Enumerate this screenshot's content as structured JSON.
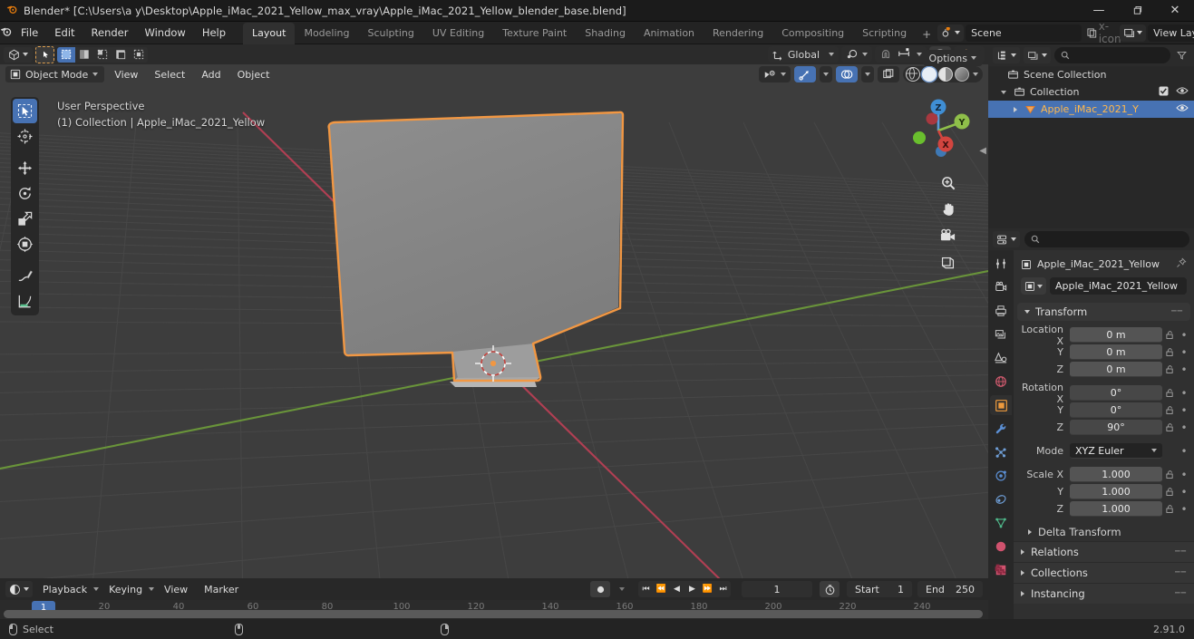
{
  "window": {
    "title": "Blender* [C:\\Users\\a y\\Desktop\\Apple_iMac_2021_Yellow_max_vray\\Apple_iMac_2021_Yellow_blender_base.blend]",
    "logo_icon": "blender-logo-icon",
    "minimize_icon": "minimize-icon",
    "maximize_icon": "maximize-icon",
    "close_icon": "close-icon"
  },
  "topbar": {
    "menus": [
      "File",
      "Edit",
      "Render",
      "Window",
      "Help"
    ],
    "workspaces": [
      {
        "label": "Layout",
        "active": true
      },
      {
        "label": "Modeling",
        "active": false
      },
      {
        "label": "Sculpting",
        "active": false
      },
      {
        "label": "UV Editing",
        "active": false
      },
      {
        "label": "Texture Paint",
        "active": false
      },
      {
        "label": "Shading",
        "active": false
      },
      {
        "label": "Animation",
        "active": false
      },
      {
        "label": "Rendering",
        "active": false
      },
      {
        "label": "Compositing",
        "active": false
      },
      {
        "label": "Scripting",
        "active": false
      }
    ],
    "add_workspace": "+",
    "scene_name": "Scene",
    "view_layer_name": "View Layer",
    "new_scene_icon": "duplicate-icon",
    "remove_scene_icon": "x-icon"
  },
  "viewport": {
    "editor_type_icon": "editor-type-icon",
    "mode": "Object Mode",
    "menus": [
      "View",
      "Select",
      "Add",
      "Object"
    ],
    "transform_orientation": "Global",
    "orientation_icon": "orientation-icon",
    "pivot_icon": "pivot-point-icon",
    "snap_icon": "magnet-icon",
    "snap_to_icon": "snap-increment-icon",
    "proportional_icon": "proportional-edit-icon",
    "falloff_icon": "falloff-curve-icon",
    "options_label": "Options",
    "select_mode_icons": [
      "select-box-icon",
      "select-extend-icon",
      "select-subtract-icon",
      "select-invert-icon",
      "select-intersect-icon"
    ],
    "cursor_icon": "cursor-icon",
    "visibility_icon": "show-hide-icon",
    "gizmo_icon": "gizmo-icon",
    "overlays_icon": "overlays-icon",
    "xray_icon": "toggle-xray-icon",
    "shading_modes": [
      "wireframe-shading-icon",
      "solid-shading-icon",
      "material-preview-icon",
      "rendered-shading-icon"
    ],
    "overlay_line1": "User Perspective",
    "overlay_line2": "(1) Collection | Apple_iMac_2021_Yellow",
    "tools": [
      {
        "name": "tweak-tool",
        "active": true
      },
      {
        "name": "cursor-tool",
        "active": false
      },
      {
        "name": "move-tool",
        "active": false
      },
      {
        "name": "rotate-tool",
        "active": false
      },
      {
        "name": "scale-tool",
        "active": false
      },
      {
        "name": "transform-tool",
        "active": false
      },
      {
        "name": "annotate-tool",
        "active": false
      },
      {
        "name": "measure-tool",
        "active": false
      }
    ],
    "gizmo_axes": [
      "Z",
      "Y",
      "X"
    ],
    "nav_buttons": [
      "zoom-icon",
      "pan-hand-icon",
      "camera-view-icon",
      "ortho-persp-icon"
    ],
    "colors": {
      "background": "#3d3d3d",
      "object_outline": "#f19743",
      "x_axis": "#c7415a",
      "y_axis": "#7bab3b",
      "accent": "#4772b3"
    }
  },
  "timeline": {
    "editor_icon": "timeline-editor-icon",
    "menus": [
      "Playback",
      "Keying",
      "View",
      "Marker"
    ],
    "record_icon": "auto-keying-icon",
    "transport_icons": [
      "jump-start-icon",
      "prev-keyframe-icon",
      "play-reverse-icon",
      "play-icon",
      "next-keyframe-icon",
      "jump-end-icon"
    ],
    "current_frame": "1",
    "clock_icon": "use-preview-range-icon",
    "start_label": "Start",
    "start_value": "1",
    "end_label": "End",
    "end_value": "250",
    "ruler_ticks": [
      "20",
      "40",
      "60",
      "80",
      "100",
      "120",
      "140",
      "160",
      "180",
      "200",
      "220",
      "240"
    ],
    "playhead_frame": "1"
  },
  "outliner": {
    "display_mode_icon": "outliner-display-mode-icon",
    "filter_id_icon": "id-type-filter-icon",
    "search_placeholder": "",
    "search_icon": "search-icon",
    "filter_icon": "filter-funnel-icon",
    "rows": [
      {
        "label": "Scene Collection",
        "icon": "scene-collection-icon",
        "indent": 0,
        "disclosure": "",
        "selected": false,
        "checkbox": false,
        "eye": false
      },
      {
        "label": "Collection",
        "icon": "collection-icon",
        "indent": 1,
        "disclosure": "down",
        "selected": false,
        "checkbox": true,
        "eye": true
      },
      {
        "label": "Apple_iMac_2021_Y",
        "icon": "mesh-object-icon",
        "indent": 2,
        "disclosure": "right",
        "selected": true,
        "checkbox": false,
        "eye": true
      }
    ]
  },
  "properties": {
    "editor_icon": "properties-editor-icon",
    "search_placeholder": "",
    "search_icon": "search-icon",
    "tabs": [
      {
        "name": "tool-tab",
        "icon": "tool-icon",
        "color": "#c8c8c8",
        "active": false
      },
      {
        "name": "render-tab",
        "icon": "render-camera-icon",
        "color": "#c8c8c8",
        "active": false
      },
      {
        "name": "output-tab",
        "icon": "printer-icon",
        "color": "#c8c8c8",
        "active": false
      },
      {
        "name": "view-layer-tab",
        "icon": "images-icon",
        "color": "#c8c8c8",
        "active": false
      },
      {
        "name": "scene-tab",
        "icon": "scene-cone-icon",
        "color": "#c8c8c8",
        "active": false
      },
      {
        "name": "world-tab",
        "icon": "world-globe-icon",
        "color": "#d05a6e",
        "active": false
      },
      {
        "name": "object-tab",
        "icon": "object-square-icon",
        "color": "#ed9a3d",
        "active": true
      },
      {
        "name": "modifiers-tab",
        "icon": "wrench-icon",
        "color": "#5b8fd4",
        "active": false
      },
      {
        "name": "particles-tab",
        "icon": "particles-icon",
        "color": "#6f9fd8",
        "active": false
      },
      {
        "name": "physics-tab",
        "icon": "physics-orbit-icon",
        "color": "#5b8fd4",
        "active": false
      },
      {
        "name": "constraints-tab",
        "icon": "constraints-icon",
        "color": "#6f9fd8",
        "active": false
      },
      {
        "name": "object-data-tab",
        "icon": "mesh-data-triangle-icon",
        "color": "#4fba8b",
        "active": false
      },
      {
        "name": "material-tab",
        "icon": "material-sphere-icon",
        "color": "#d0526e",
        "active": false
      },
      {
        "name": "texture-tab",
        "icon": "texture-checker-icon",
        "color": "#d0526e",
        "active": false
      }
    ],
    "breadcrumb_icon": "object-square-icon",
    "breadcrumb": "Apple_iMac_2021_Yellow",
    "pin_icon": "pin-icon",
    "object_name": "Apple_iMac_2021_Yellow",
    "object_icon": "object-square-icon",
    "transform": {
      "title": "Transform",
      "rows": [
        {
          "label": "Location X",
          "value": "0 m",
          "style": "light"
        },
        {
          "label": "Y",
          "value": "0 m",
          "style": "light"
        },
        {
          "label": "Z",
          "value": "0 m",
          "style": "light"
        },
        {
          "label": "Rotation X",
          "value": "0°",
          "style": "dim"
        },
        {
          "label": "Y",
          "value": "0°",
          "style": "dim"
        },
        {
          "label": "Z",
          "value": "90°",
          "style": "dim"
        }
      ],
      "mode_label": "Mode",
      "mode_value": "XYZ Euler",
      "scale_rows": [
        {
          "label": "Scale X",
          "value": "1.000",
          "style": "light"
        },
        {
          "label": "Y",
          "value": "1.000",
          "style": "light"
        },
        {
          "label": "Z",
          "value": "1.000",
          "style": "light"
        }
      ],
      "delta_transform": "Delta Transform"
    },
    "sections": [
      "Relations",
      "Collections",
      "Instancing"
    ]
  },
  "statusbar": {
    "mouse_left_label": "Select",
    "mouse_middle_label": "",
    "mouse_right_label": "",
    "version": "2.91.0"
  }
}
